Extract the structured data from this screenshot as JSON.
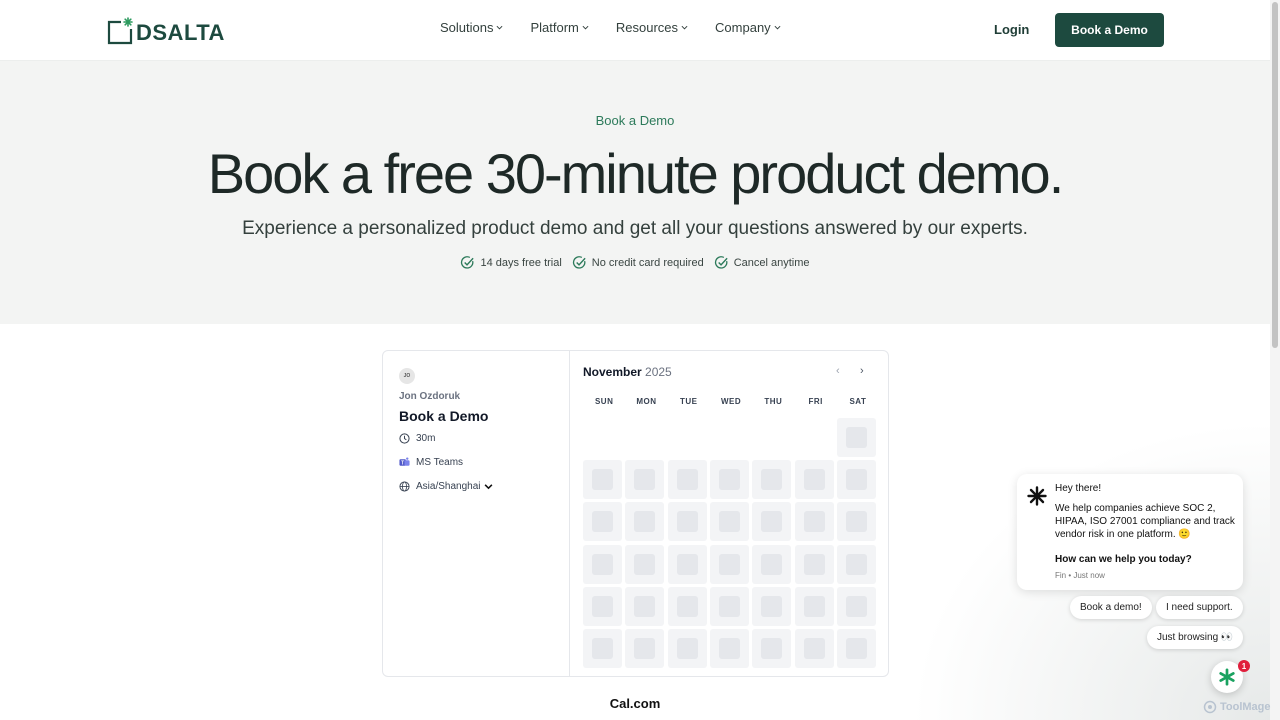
{
  "header": {
    "logo_text": "DSALTA",
    "nav": [
      "Solutions",
      "Platform",
      "Resources",
      "Company"
    ],
    "login_label": "Login",
    "cta_label": "Book a Demo"
  },
  "hero": {
    "eyebrow": "Book a Demo",
    "title": "Book a free 30-minute product demo.",
    "subtitle": "Experience a personalized product demo and get all your questions answered by our experts.",
    "checks": [
      "14 days free trial",
      "No credit card required",
      "Cancel anytime"
    ]
  },
  "booker": {
    "avatar_initials": "JO",
    "host": "Jon Ozdoruk",
    "event_title": "Book a Demo",
    "duration": "30m",
    "location": "MS Teams",
    "timezone": "Asia/Shanghai",
    "month": "November",
    "year": "2025",
    "weekdays": [
      "SUN",
      "MON",
      "TUE",
      "WED",
      "THU",
      "FRI",
      "SAT"
    ]
  },
  "footer": {
    "powered_by": "Cal.com"
  },
  "chat": {
    "greeting": "Hey there!",
    "message": "We help companies achieve SOC 2, HIPAA, ISO 27001 compliance and track vendor risk in one platform. 🙂",
    "question": "How can we help you today?",
    "meta": "Fin • Just now",
    "replies": [
      "Book a demo!",
      "I need support.",
      "Just browsing 👀"
    ],
    "badge_count": "1"
  },
  "watermark": "ToolMage",
  "colors": {
    "brand": "#1d4a3f",
    "accent": "#2c7a5a",
    "hero_bg": "#f3f4f3"
  }
}
